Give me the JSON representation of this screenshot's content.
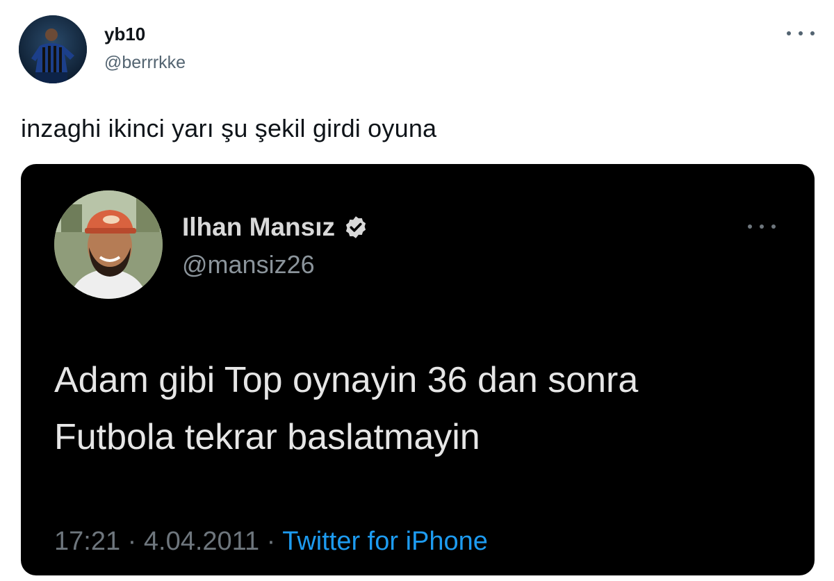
{
  "outer_tweet": {
    "display_name": "yb10",
    "handle": "@berrrkke",
    "text": "inzaghi ikinci yarı şu şekil girdi oyuna",
    "more_icon": "more-horizontal-icon"
  },
  "embedded_tweet": {
    "display_name": "Ilhan Mansız",
    "verified_icon": "verified-badge-icon",
    "handle": "@mansiz26",
    "text_line1": "Adam gibi Top oynayin 36 dan sonra",
    "text_line2": "Futbola tekrar baslatmayin",
    "time": "17:21",
    "separator": "·",
    "date": "4.04.2011",
    "source": "Twitter for iPhone",
    "more_icon": "more-horizontal-icon"
  },
  "colors": {
    "text_primary": "#0f1419",
    "text_secondary": "#536471",
    "card_background": "#000000",
    "link_blue": "#1d9bf0"
  }
}
